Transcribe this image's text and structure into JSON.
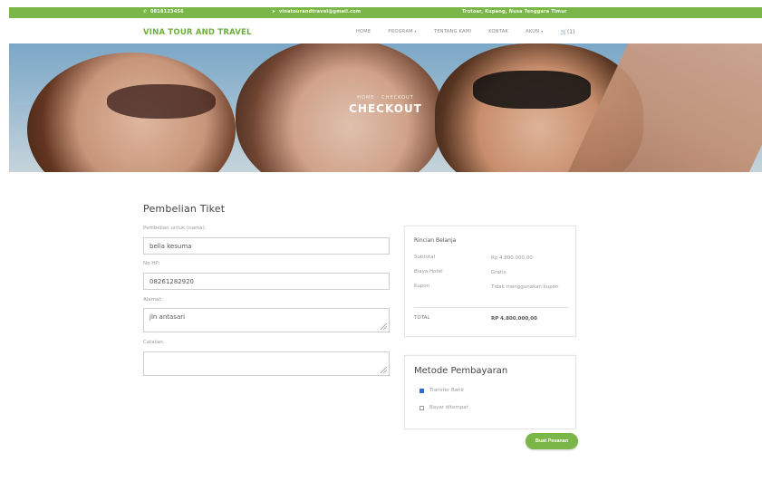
{
  "topbar": {
    "phone": "0818123456",
    "email": "vinatourandtravel@gmail.com",
    "address": "Trotoar, Kupang, Nusa Tenggara Timur"
  },
  "nav": {
    "brand": "VINA TOUR AND TRAVEL",
    "items": [
      {
        "label": "HOME"
      },
      {
        "label": "PROGRAM",
        "caret": "▾"
      },
      {
        "label": "TENTANG KAMI"
      },
      {
        "label": "KONTAK"
      },
      {
        "label": "AKUN",
        "caret": "▾"
      }
    ],
    "cart_label": "(1)"
  },
  "hero": {
    "breadcrumb": "HOME · CHECKOUT",
    "title": "CHECKOUT"
  },
  "form": {
    "title": "Pembelian Tiket",
    "name_label": "Pembelian untuk (nama):",
    "name_value": "bella kesuma",
    "phone_label": "No HP:",
    "phone_value": "08261282920",
    "address_label": "Alamat:",
    "address_value": "jln antasari",
    "notes_label": "Catatan:",
    "notes_value": ""
  },
  "summary": {
    "title": "Rincian Belanja",
    "subtotal_label": "Subtotal",
    "subtotal_value": "Rp 4.800.000,00",
    "hotel_label": "Biaya Hotel",
    "hotel_value": "Gratis",
    "coupon_label": "Kupon",
    "coupon_value": "Tidak menggunakan kupon",
    "total_label": "TOTAL",
    "total_value": "RP 4.800.000,00"
  },
  "payment": {
    "title": "Metode Pembayaran",
    "options": [
      {
        "label": "Transfer Bank",
        "checked": true
      },
      {
        "label": "Bayar ditempat",
        "checked": false
      }
    ]
  },
  "submit_label": "Buat Pesanan",
  "colors": {
    "accent": "#7ab648",
    "brand": "#6fae3c",
    "radio_checked": "#2b6fd6"
  }
}
